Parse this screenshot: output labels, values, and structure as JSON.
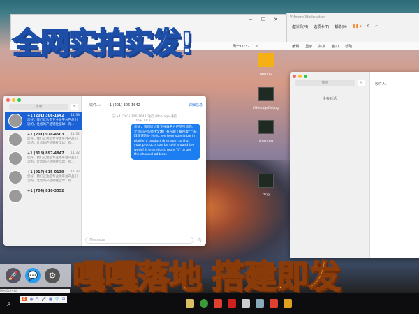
{
  "overlay": {
    "title": "全网实拍实发!",
    "subtitle": "嘎嘎落地 搭建即发"
  },
  "host_window": {
    "controls": [
      "−",
      "☐",
      "✕"
    ]
  },
  "vmware": {
    "title": "VMware Workstation",
    "menu": [
      "虚拟机(M)",
      "选项卡(T)",
      "帮助(H)"
    ]
  },
  "mac_menubar": {
    "items": [
      "编辑",
      "显示",
      "好友",
      "窗口",
      "帮助"
    ],
    "clock": "周一11:32"
  },
  "desktop_icons": [
    {
      "label": "MACOS"
    },
    {
      "label": "iMessageDebug"
    },
    {
      "label": "chaxmsg"
    },
    {
      "label": "ding"
    }
  ],
  "messages": {
    "search_placeholder": "搜索",
    "to_label": "收件人:",
    "to_value": "+1 (201) 306-1642",
    "details": "详细信息",
    "note": "与\"+1 (201) 306-1642\"进行 iMessage 通信",
    "note_time": "今天 11:32",
    "bubble": "您好，我们这边是专业做平台产品引流的，让您的产品销往全球！有兴趣了解回复\"Y\"获取频道地址 Hello, we here specialize in platform product drainage, so that your products can be sold around the world! If interested, reply \"Y\" to get the channel address",
    "input_placeholder": "iMessage",
    "conversations": [
      {
        "name": "+1 (201) 306-1642",
        "time": "11:33",
        "preview": "您好，我们这边是专业做平台产品引流的，让您的产品销往全球！有...",
        "selected": true
      },
      {
        "name": "+1 (201) 978-4503",
        "time": "11:32",
        "preview": "您好，我们这边是专业做平台产品引流的，让您的产品销往全球！有..."
      },
      {
        "name": "+1 (818) 897-4847",
        "time": "11:32",
        "preview": "您好，我们这边是专业做平台产品引流的，让您的产品销往全球！有..."
      },
      {
        "name": "+1 (917) 615-0139",
        "time": "11:32",
        "preview": "您好，我们这边是专业做平台产品引流的，让您的产品销往全球！有..."
      },
      {
        "name": "+1 (704) 816-3552",
        "time": "",
        "preview": ""
      }
    ]
  },
  "messages2": {
    "search_placeholder": "搜索",
    "to_label": "收件人:",
    "empty": "没有对话"
  },
  "dock_hint": "退出 Ctrl+Alt",
  "ime": {
    "logo": "S",
    "items": [
      "中",
      "°,",
      "🎤",
      "▦",
      "👕",
      "⊞"
    ]
  }
}
